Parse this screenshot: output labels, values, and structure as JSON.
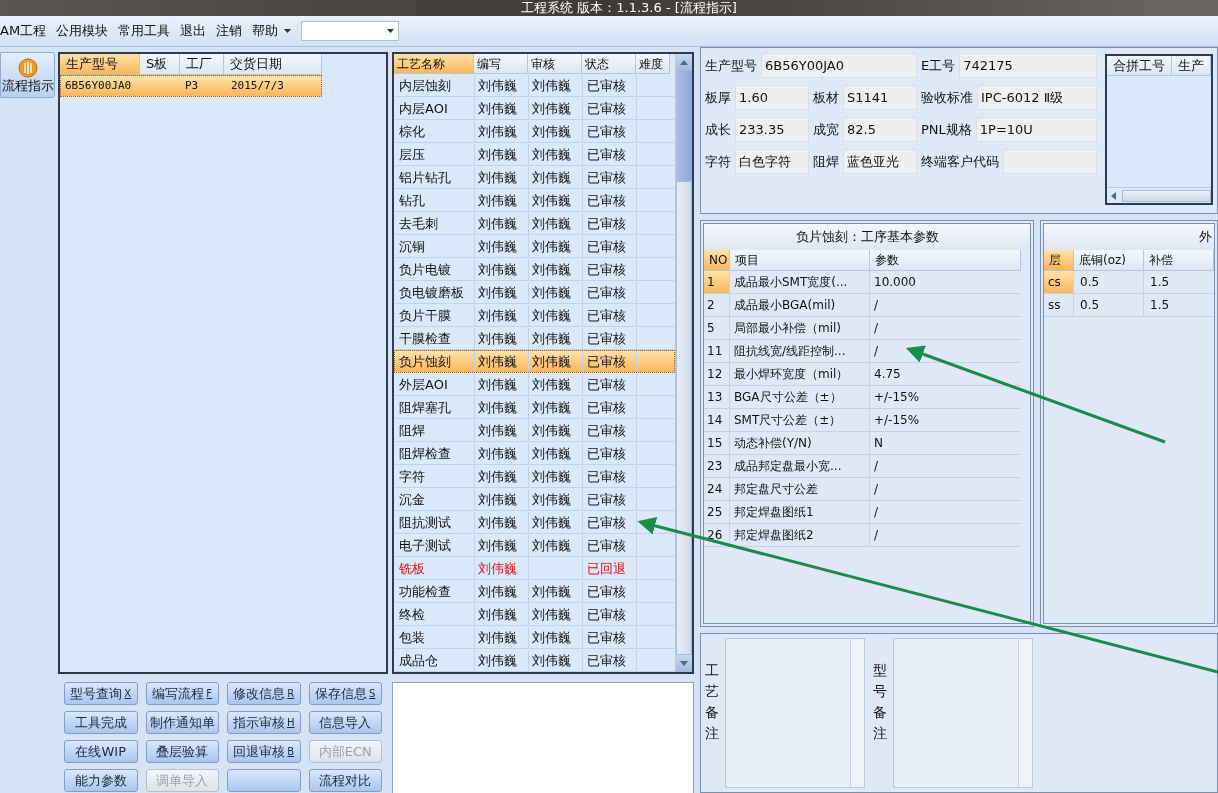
{
  "window": {
    "title": "工程系统   版本：1.1.3.6 - [流程指示]"
  },
  "menu": [
    "AM工程",
    "公用模块",
    "常用工具",
    "退出",
    "注销",
    "帮助"
  ],
  "side_button": {
    "label": "流程指示"
  },
  "orders": {
    "columns": [
      "生产型号",
      "S板",
      "工厂",
      "交货日期"
    ],
    "rows": [
      {
        "model": "6B56Y00JA0",
        "factory": "P3",
        "date": "2015/7/3",
        "selected": true
      }
    ]
  },
  "process": {
    "columns": [
      "工艺名称",
      "编写",
      "审核",
      "状态",
      "难度"
    ],
    "rows": [
      {
        "name": "内层蚀刻",
        "author": "刘伟巍",
        "reviewer": "刘伟巍",
        "status": "已审核",
        "returned": false,
        "selected": false
      },
      {
        "name": "内层AOI",
        "author": "刘伟巍",
        "reviewer": "刘伟巍",
        "status": "已审核",
        "returned": false,
        "selected": false
      },
      {
        "name": "棕化",
        "author": "刘伟巍",
        "reviewer": "刘伟巍",
        "status": "已审核",
        "returned": false,
        "selected": false
      },
      {
        "name": "层压",
        "author": "刘伟巍",
        "reviewer": "刘伟巍",
        "status": "已审核",
        "returned": false,
        "selected": false
      },
      {
        "name": "铝片钻孔",
        "author": "刘伟巍",
        "reviewer": "刘伟巍",
        "status": "已审核",
        "returned": false,
        "selected": false
      },
      {
        "name": "钻孔",
        "author": "刘伟巍",
        "reviewer": "刘伟巍",
        "status": "已审核",
        "returned": false,
        "selected": false
      },
      {
        "name": "去毛刺",
        "author": "刘伟巍",
        "reviewer": "刘伟巍",
        "status": "已审核",
        "returned": false,
        "selected": false
      },
      {
        "name": "沉铜",
        "author": "刘伟巍",
        "reviewer": "刘伟巍",
        "status": "已审核",
        "returned": false,
        "selected": false
      },
      {
        "name": "负片电镀",
        "author": "刘伟巍",
        "reviewer": "刘伟巍",
        "status": "已审核",
        "returned": false,
        "selected": false
      },
      {
        "name": "负电镀磨板",
        "author": "刘伟巍",
        "reviewer": "刘伟巍",
        "status": "已审核",
        "returned": false,
        "selected": false
      },
      {
        "name": "负片干膜",
        "author": "刘伟巍",
        "reviewer": "刘伟巍",
        "status": "已审核",
        "returned": false,
        "selected": false
      },
      {
        "name": "干膜检查",
        "author": "刘伟巍",
        "reviewer": "刘伟巍",
        "status": "已审核",
        "returned": false,
        "selected": false
      },
      {
        "name": "负片蚀刻",
        "author": "刘伟巍",
        "reviewer": "刘伟巍",
        "status": "已审核",
        "returned": false,
        "selected": true
      },
      {
        "name": "外层AOI",
        "author": "刘伟巍",
        "reviewer": "刘伟巍",
        "status": "已审核",
        "returned": false,
        "selected": false
      },
      {
        "name": "阻焊塞孔",
        "author": "刘伟巍",
        "reviewer": "刘伟巍",
        "status": "已审核",
        "returned": false,
        "selected": false
      },
      {
        "name": "阻焊",
        "author": "刘伟巍",
        "reviewer": "刘伟巍",
        "status": "已审核",
        "returned": false,
        "selected": false
      },
      {
        "name": "阻焊检查",
        "author": "刘伟巍",
        "reviewer": "刘伟巍",
        "status": "已审核",
        "returned": false,
        "selected": false
      },
      {
        "name": "字符",
        "author": "刘伟巍",
        "reviewer": "刘伟巍",
        "status": "已审核",
        "returned": false,
        "selected": false
      },
      {
        "name": "沉金",
        "author": "刘伟巍",
        "reviewer": "刘伟巍",
        "status": "已审核",
        "returned": false,
        "selected": false
      },
      {
        "name": "阻抗测试",
        "author": "刘伟巍",
        "reviewer": "刘伟巍",
        "status": "已审核",
        "returned": false,
        "selected": false
      },
      {
        "name": "电子测试",
        "author": "刘伟巍",
        "reviewer": "刘伟巍",
        "status": "已审核",
        "returned": false,
        "selected": false
      },
      {
        "name": "铣板",
        "author": "刘伟巍",
        "status": "已回退",
        "returned": true,
        "selected": false
      },
      {
        "name": "功能检查",
        "author": "刘伟巍",
        "reviewer": "刘伟巍",
        "status": "已审核",
        "returned": false,
        "selected": false
      },
      {
        "name": "终检",
        "author": "刘伟巍",
        "reviewer": "刘伟巍",
        "status": "已审核",
        "returned": false,
        "selected": false
      },
      {
        "name": "包装",
        "author": "刘伟巍",
        "reviewer": "刘伟巍",
        "status": "已审核",
        "returned": false,
        "selected": false
      },
      {
        "name": "成品仓",
        "author": "刘伟巍",
        "reviewer": "刘伟巍",
        "status": "已审核",
        "returned": false,
        "selected": false
      }
    ]
  },
  "buttons": [
    {
      "label": "型号查询",
      "key": "X",
      "disabled": false
    },
    {
      "label": "编写流程",
      "key": "F",
      "disabled": false
    },
    {
      "label": "修改信息",
      "key": "R",
      "disabled": false
    },
    {
      "label": "保存信息",
      "key": "S",
      "disabled": false
    },
    {
      "label": "工具完成",
      "disabled": false
    },
    {
      "label": "制作通知单",
      "disabled": false
    },
    {
      "label": "指示审核",
      "key": "H",
      "disabled": false
    },
    {
      "label": "信息导入",
      "disabled": false
    },
    {
      "label": "在线WIP",
      "disabled": false
    },
    {
      "label": "叠层验算",
      "disabled": false
    },
    {
      "label": "回退审核",
      "key": "B",
      "disabled": false
    },
    {
      "label": "内部ECN",
      "disabled": true
    },
    {
      "label": "能力参数",
      "disabled": false
    },
    {
      "label": "调单导入",
      "disabled": true
    },
    {
      "disabled": false
    },
    {
      "label": "流程对比",
      "disabled": false
    }
  ],
  "info": {
    "top": [
      {
        "label": "生产型号",
        "value": "6B56Y00JA0"
      },
      {
        "label": "E工号",
        "value": "742175"
      }
    ],
    "rows": [
      [
        {
          "label": "板厚",
          "value": "1.60"
        },
        {
          "label": "板材",
          "value": "S1141"
        },
        {
          "label": "验收标准",
          "value": "IPC-6012 Ⅱ级"
        }
      ],
      [
        {
          "label": "成长",
          "value": "233.35"
        },
        {
          "label": "成宽",
          "value": "82.5"
        },
        {
          "label": "PNL规格",
          "value": "1P=10U"
        }
      ],
      [
        {
          "label": "字符",
          "value": "白色字符"
        },
        {
          "label": "阻焊",
          "value": "蓝色亚光"
        },
        {
          "label": "终端客户代码"
        }
      ]
    ]
  },
  "merge_table": {
    "columns": [
      "合拼工号",
      "生产"
    ]
  },
  "params": {
    "title": "负片蚀刻：工序基本参数",
    "columns": [
      "NO",
      "项目",
      "参数"
    ],
    "rows": [
      {
        "no": "1",
        "item": "成品最小SMT宽度(...",
        "value": "10.000",
        "selected": true
      },
      {
        "no": "2",
        "item": "成品最小BGA(mil)",
        "value": "/",
        "selected": false
      },
      {
        "no": "5",
        "item": "局部最小补偿（mil)",
        "value": "/",
        "selected": false
      },
      {
        "no": "11",
        "item": "阻抗线宽/线距控制...",
        "value": "/",
        "selected": false
      },
      {
        "no": "12",
        "item": "最小焊环宽度（mil）",
        "value": "4.75",
        "selected": false
      },
      {
        "no": "13",
        "item": "BGA尺寸公差（±）",
        "value": "+/-15%",
        "selected": false
      },
      {
        "no": "14",
        "item": "SMT尺寸公差（±）",
        "value": "+/-15%",
        "selected": false
      },
      {
        "no": "15",
        "item": "动态补偿(Y/N)",
        "value": "N",
        "selected": false
      },
      {
        "no": "23",
        "item": "成品邦定盘最小宽...",
        "value": "/",
        "selected": false
      },
      {
        "no": "24",
        "item": "邦定盘尺寸公差",
        "value": "/",
        "selected": false
      },
      {
        "no": "25",
        "item": "邦定焊盘图纸1",
        "value": "/",
        "selected": false
      },
      {
        "no": "26",
        "item": "邦定焊盘图纸2",
        "value": "/",
        "selected": false
      }
    ]
  },
  "layers": {
    "title": "外",
    "columns": [
      "层",
      "底铜(oz)",
      "补偿"
    ],
    "rows": [
      {
        "layer": "cs",
        "copper": "0.5",
        "comp": "1.5",
        "selected": true
      },
      {
        "layer": "ss",
        "copper": "0.5",
        "comp": "1.5",
        "selected": false
      }
    ]
  },
  "remarks": [
    {
      "label": "工艺备注"
    },
    {
      "label": "型号备注"
    }
  ]
}
